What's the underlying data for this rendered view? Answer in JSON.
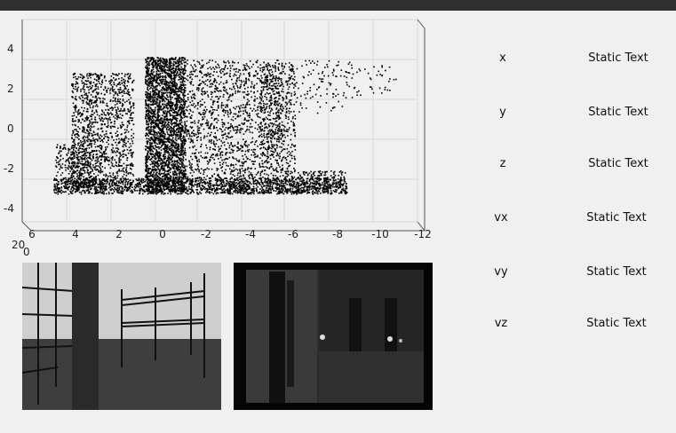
{
  "plot": {
    "y_ticks": [
      "4",
      "2",
      "0",
      "-2",
      "-4"
    ],
    "x_ticks": [
      "6",
      "4",
      "2",
      "0",
      "-2",
      "-4",
      "-6",
      "-8",
      "-10",
      "-12"
    ],
    "z_ticks": [
      "20",
      "0"
    ],
    "point_color": "#000000"
  },
  "panels": [
    {
      "label": "x",
      "value": "Static Text"
    },
    {
      "label": "y",
      "value": "Static Text"
    },
    {
      "label": "z",
      "value": "Static Text"
    },
    {
      "label": "vx",
      "value": "Static Text"
    },
    {
      "label": "vy",
      "value": "Static Text"
    },
    {
      "label": "vz",
      "value": "Static Text"
    }
  ],
  "colors": {
    "window_bg": "#f0f0f0",
    "titlebar": "#2f2f2f",
    "grid": "#d8d8d8"
  }
}
